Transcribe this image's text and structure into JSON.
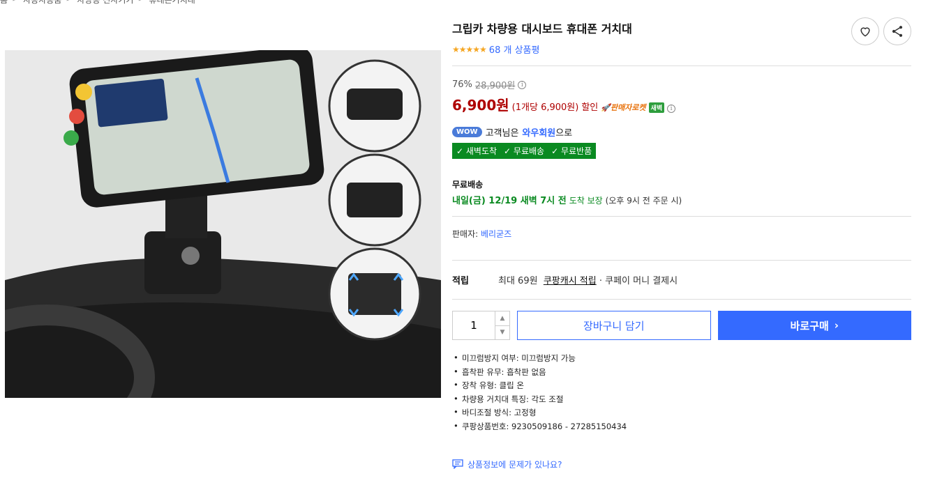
{
  "breadcrumb": [
    "홈",
    "자동차용품",
    "차량용 전자기기",
    "휴대폰거치대"
  ],
  "product": {
    "title": "그립카 차량용 대시보드 휴대폰 거치대",
    "stars": "★★★★★",
    "review_count": "68 개 상품평"
  },
  "price": {
    "discount": "76%",
    "original": "28,900원",
    "sale": "6,900원",
    "unit": "(1개당 6,900원)",
    "discount_label": "할인",
    "rocket_label": "🚀판매자로켓",
    "dawn_tag": "새벽"
  },
  "wow": {
    "badge": "WOW",
    "text_pre": "고객님은",
    "member": "와우회원",
    "text_post": "으로",
    "benefits": [
      "새벽도착",
      "무료배송",
      "무료반품"
    ]
  },
  "shipping": {
    "label": "무료배송",
    "date": "내일(금) 12/19 새벽 7시 전",
    "arrival": "도착 보장",
    "note": "(오후 9시 전 주문 시)"
  },
  "seller": {
    "label": "판매자:",
    "name": "베리굳즈"
  },
  "reward": {
    "label": "적립",
    "text_pre": "최대 69원",
    "link": "쿠팡캐시 적립",
    "text_post": "· 쿠페이 머니 결제시"
  },
  "purchase": {
    "quantity": "1",
    "cart_label": "장바구니 담기",
    "buy_label": "바로구매"
  },
  "specs": [
    "미끄럼방지 여부: 미끄럼방지 가능",
    "흡착판 유무: 흡착판 없음",
    "장착 유형: 클립 온",
    "차량용 거치대 특징: 각도 조절",
    "바디조절 방식: 고정형",
    "쿠팡상품번호: 9230509186 - 27285150434"
  ],
  "report_label": "상품정보에 문제가 있나요?",
  "colors": {
    "accent": "#346aff",
    "sale_red": "#ae0000",
    "green": "#0a8a21"
  }
}
